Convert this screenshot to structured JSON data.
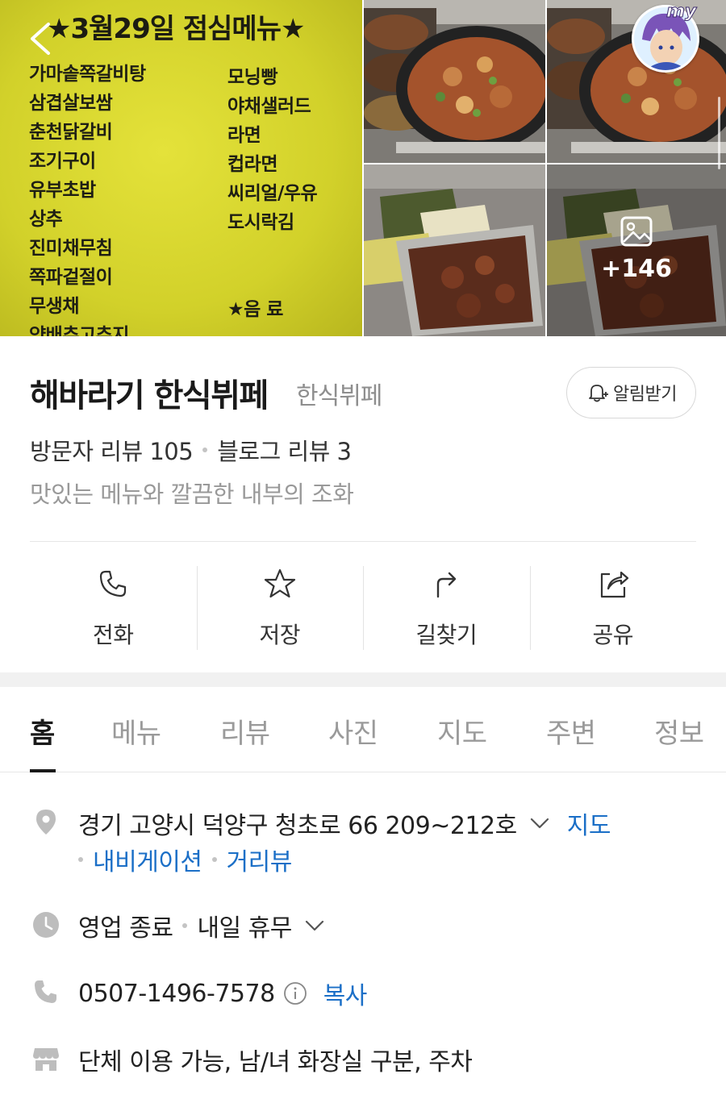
{
  "photos": {
    "menu_board": {
      "title": "★3월29일 점심메뉴★",
      "left_items": [
        "가마솥쪽갈비탕",
        "삼겹살보쌈",
        "춘천닭갈비",
        "조기구이",
        "유부초밥",
        "상추",
        "진미채무침",
        "쪽파겉절이",
        "무생채",
        "양배추고추지"
      ],
      "right_items": [
        "모닝빵",
        "야채샐러드",
        "라면",
        "컵라면",
        "씨리얼/우유",
        "도시락김",
        "",
        "",
        "★음 료"
      ]
    },
    "more_count": "+146",
    "avatar_label": "my"
  },
  "place": {
    "name": "해바라기 한식뷔페",
    "category": "한식뷔페",
    "notify_label": "알림받기",
    "visitor_review": "방문자 리뷰 105",
    "blog_review": "블로그 리뷰 3",
    "tagline": "맛있는 메뉴와 깔끔한 내부의 조화"
  },
  "actions": [
    {
      "label": "전화",
      "icon": "phone-icon"
    },
    {
      "label": "저장",
      "icon": "star-icon"
    },
    {
      "label": "길찾기",
      "icon": "directions-icon"
    },
    {
      "label": "공유",
      "icon": "share-icon"
    }
  ],
  "tabs": [
    "홈",
    "메뉴",
    "리뷰",
    "사진",
    "지도",
    "주변",
    "정보"
  ],
  "active_tab": "홈",
  "details": {
    "address": "경기 고양시 덕양구 청초로 66 209~212호",
    "address_map_link": "지도",
    "navigation_link": "내비게이션",
    "street_view_link": "거리뷰",
    "hours_status": "영업 종료",
    "hours_next": "내일 휴무",
    "phone": "0507-1496-7578",
    "copy_label": "복사",
    "amenities": "단체 이용 가능, 남/녀 화장실 구분, 주차"
  },
  "colors": {
    "link": "#1b6fc7",
    "menu_board": "#d6d42c",
    "icon_gray": "#bdbdbd"
  }
}
